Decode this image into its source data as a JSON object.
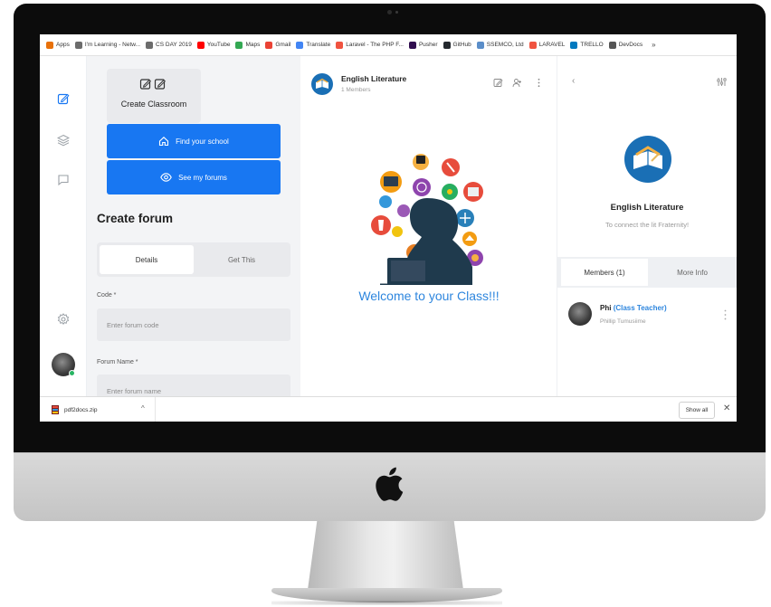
{
  "bookmarks": [
    {
      "label": "Apps",
      "color": "#e8710a"
    },
    {
      "label": "I'm Learning - Netw...",
      "color": "#6c6c6c"
    },
    {
      "label": "CS DAY 2019",
      "color": "#6c6c6c"
    },
    {
      "label": "YouTube",
      "color": "#ff0000"
    },
    {
      "label": "Maps",
      "color": "#34a853"
    },
    {
      "label": "Gmail",
      "color": "#ea4335"
    },
    {
      "label": "Translate",
      "color": "#4285f4"
    },
    {
      "label": "Laravel - The PHP F...",
      "color": "#f05340"
    },
    {
      "label": "Pusher",
      "color": "#300d4f"
    },
    {
      "label": "GitHub",
      "color": "#24292e"
    },
    {
      "label": "SSEMCO, Ltd",
      "color": "#5b8ec9"
    },
    {
      "label": "LARAVEL",
      "color": "#f05340"
    },
    {
      "label": "TRELLO",
      "color": "#0079bf"
    },
    {
      "label": "DevDocs",
      "color": "#555555"
    }
  ],
  "bookmarks_more": "»",
  "sidebar": {
    "create_classroom": "Create Classroom",
    "find_school": "Find your school",
    "see_forums": "See my forums",
    "create_forum_title": "Create forum",
    "tabs": [
      "Details",
      "Get This"
    ],
    "code_label": "Code *",
    "code_placeholder": "Enter forum code",
    "forum_name_label": "Forum Name *",
    "forum_name_placeholder": "Enter forum name"
  },
  "class_header": {
    "title": "English Literature",
    "members": "1 Members"
  },
  "welcome_text": "Welcome to your Class!!!",
  "class_info": {
    "back": "‹",
    "name": "English Literature",
    "description": "To connect the lit Fraternity!",
    "tabs": [
      "Members (1)",
      "More Info"
    ]
  },
  "member": {
    "name": "Phi",
    "role": "(Class Teacher)",
    "full_name": "Phillip Tumusiime"
  },
  "download": {
    "file": "pdf2docs.zip",
    "chevron": "^",
    "show_all": "Show all",
    "close": "✕"
  },
  "colors": {
    "accent_blue": "#1877f2",
    "welcome_blue": "#2e86de",
    "online_green": "#28b463"
  }
}
